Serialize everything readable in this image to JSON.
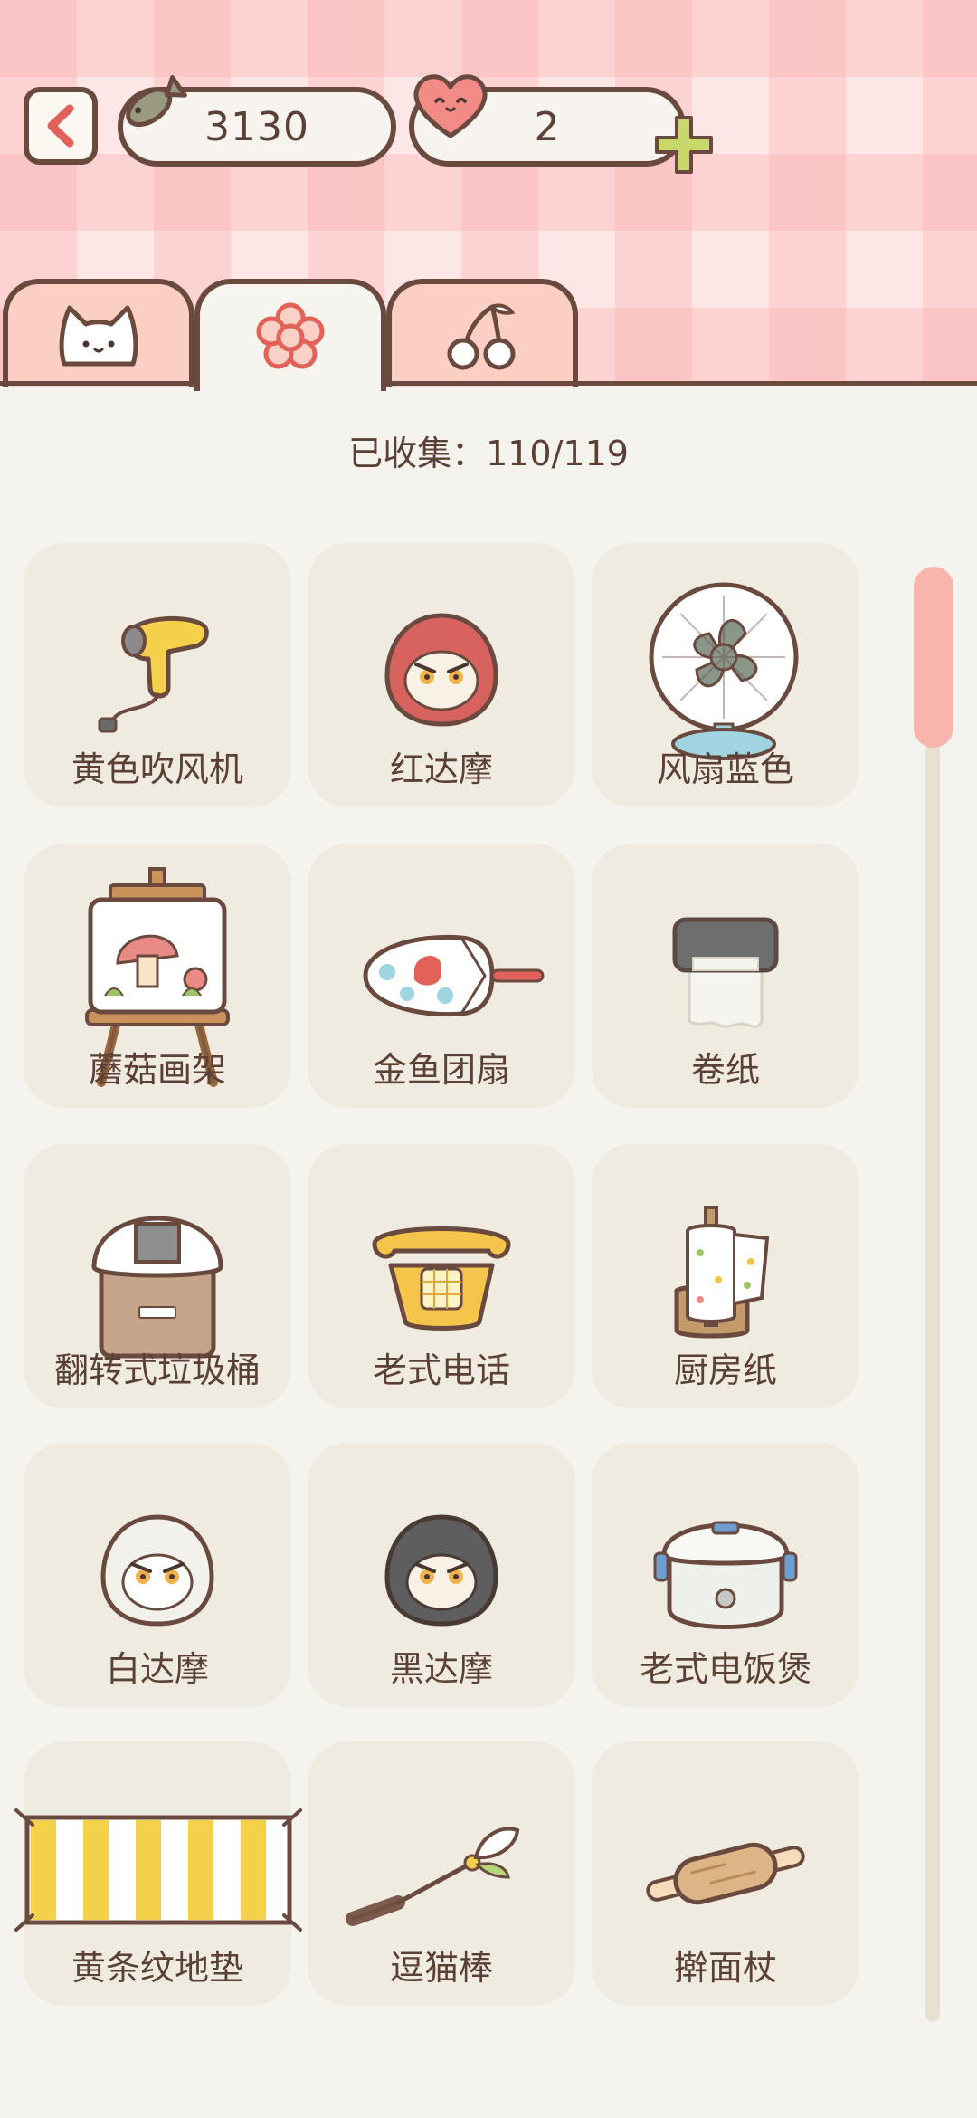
{
  "header": {
    "back_icon": "chevron-left-icon",
    "fish_count": "3130",
    "heart_count": "2",
    "fish_icon": "fish-icon",
    "heart_icon": "heart-icon",
    "add_icon": "plus-icon"
  },
  "tabs": [
    {
      "icon": "cat-face-icon",
      "active": false
    },
    {
      "icon": "flower-icon",
      "active": true
    },
    {
      "icon": "cherries-icon",
      "active": false
    }
  ],
  "collected": {
    "text": "已收集：110/119"
  },
  "items": [
    {
      "label": "黄色吹风机",
      "icon": "hair-dryer-icon"
    },
    {
      "label": "红达摩",
      "icon": "red-daruma-icon"
    },
    {
      "label": "风扇蓝色",
      "icon": "blue-fan-icon"
    },
    {
      "label": "蘑菇画架",
      "icon": "mushroom-easel-icon"
    },
    {
      "label": "金鱼团扇",
      "icon": "goldfish-fan-icon"
    },
    {
      "label": "卷纸",
      "icon": "toilet-paper-icon"
    },
    {
      "label": "翻转式垃圾桶",
      "icon": "trash-bin-icon"
    },
    {
      "label": "老式电话",
      "icon": "old-phone-icon"
    },
    {
      "label": "厨房纸",
      "icon": "kitchen-paper-icon"
    },
    {
      "label": "白达摩",
      "icon": "white-daruma-icon"
    },
    {
      "label": "黑达摩",
      "icon": "black-daruma-icon"
    },
    {
      "label": "老式电饭煲",
      "icon": "rice-cooker-icon"
    },
    {
      "label": "黄条纹地垫",
      "icon": "striped-mat-icon"
    },
    {
      "label": "逗猫棒",
      "icon": "cat-teaser-icon"
    },
    {
      "label": "擀面杖",
      "icon": "rolling-pin-icon"
    }
  ],
  "colors": {
    "outline": "#6a4a3e",
    "card_bg": "#f0ebe1",
    "page_bg": "#f5f3ee",
    "tab_inactive": "#fccfc4",
    "scroll_thumb": "#f8b4ad",
    "accent_red": "#e2625a",
    "plus_green": "#c8d86a"
  },
  "scroll": {
    "position": 0
  }
}
